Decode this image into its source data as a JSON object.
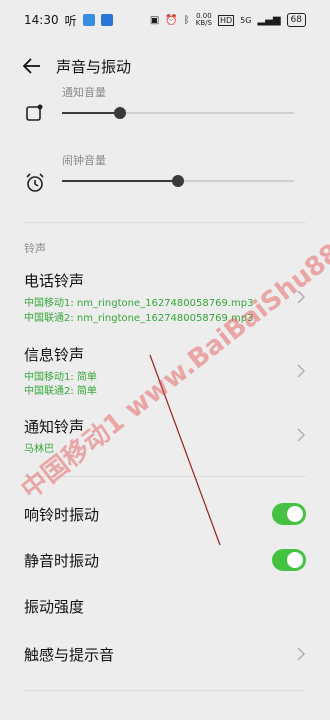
{
  "status_bar": {
    "time": "14:30",
    "app_label": "听",
    "speed_value": "0.00",
    "speed_unit": "KB/S",
    "hd_label": "HD",
    "network": "5G",
    "battery": "68"
  },
  "header": {
    "title": "声音与振动"
  },
  "sliders": [
    {
      "label": "通知音量",
      "level": 0.25
    },
    {
      "label": "闹钟音量",
      "level": 0.5
    }
  ],
  "ringtones": {
    "section_label": "铃声",
    "items": [
      {
        "title": "电话铃声",
        "lines": [
          "中国移动1: nm_ringtone_1627480058769.mp3",
          "中国联通2: nm_ringtone_1627480058769.mp3"
        ]
      },
      {
        "title": "信息铃声",
        "lines": [
          "中国移动1: 简单",
          "中国联通2: 简单"
        ]
      },
      {
        "title": "通知铃声",
        "lines": [
          "马林巴"
        ]
      }
    ]
  },
  "toggles": [
    {
      "label": "响铃时振动",
      "state": "on"
    },
    {
      "label": "静音时振动",
      "state": "on"
    }
  ],
  "rows": [
    {
      "label": "振动强度"
    },
    {
      "label": "触感与提示音"
    }
  ],
  "colors": {
    "accent": "#46c243",
    "subtitle": "#35a83a",
    "background": "#ededed"
  },
  "watermark_text": "中国移动1  www.BaiBaiShu88.Com"
}
